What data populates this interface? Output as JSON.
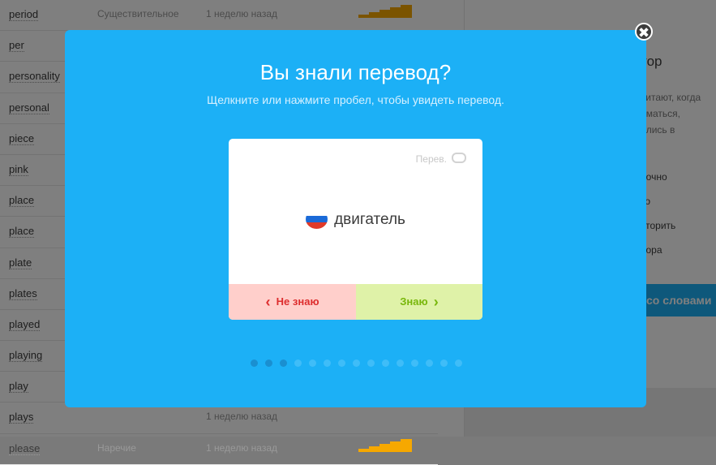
{
  "background": {
    "words": [
      {
        "word": "period",
        "pos": "Существительное",
        "when": "1 неделю назад"
      },
      {
        "word": "per",
        "pos": "",
        "when": ""
      },
      {
        "word": "personality",
        "pos": "",
        "when": ""
      },
      {
        "word": "personal",
        "pos": "",
        "when": ""
      },
      {
        "word": "piece",
        "pos": "",
        "when": ""
      },
      {
        "word": "pink",
        "pos": "",
        "when": ""
      },
      {
        "word": "place",
        "pos": "",
        "when": ""
      },
      {
        "word": "place",
        "pos": "",
        "when": ""
      },
      {
        "word": "plate",
        "pos": "",
        "when": ""
      },
      {
        "word": "plates",
        "pos": "",
        "when": ""
      },
      {
        "word": "played",
        "pos": "",
        "when": ""
      },
      {
        "word": "playing",
        "pos": "",
        "when": ""
      },
      {
        "word": "play",
        "pos": "",
        "when": ""
      },
      {
        "word": "plays",
        "pos": "",
        "when": "1 неделю назад"
      },
      {
        "word": "please",
        "pos": "Наречие",
        "when": "1 неделю назад"
      }
    ],
    "right_panel": {
      "title_fragment": "тор",
      "text_fragment": "читают, когда\nиматься,\nились в",
      "items": [
        "рочно",
        "ко",
        "вторить",
        "пора"
      ],
      "button_fragment": "со словами"
    },
    "accent_color": "#f6a800"
  },
  "modal": {
    "title": "Вы знали перевод?",
    "subtitle": "Щелкните или нажмите пробел, чтобы увидеть перевод.",
    "close_symbol": "✖",
    "card": {
      "reverse_label": "Перев.",
      "word": "двигатель",
      "language_flag": "russian-flag"
    },
    "buttons": {
      "dont_know": "Не знаю",
      "know": "Знаю"
    },
    "progress": {
      "total": 15,
      "completed": 3,
      "current": 3
    },
    "colors": {
      "modal": "#1cb0f6",
      "dont_know": "#dd2d2d",
      "know": "#78b70b"
    }
  }
}
